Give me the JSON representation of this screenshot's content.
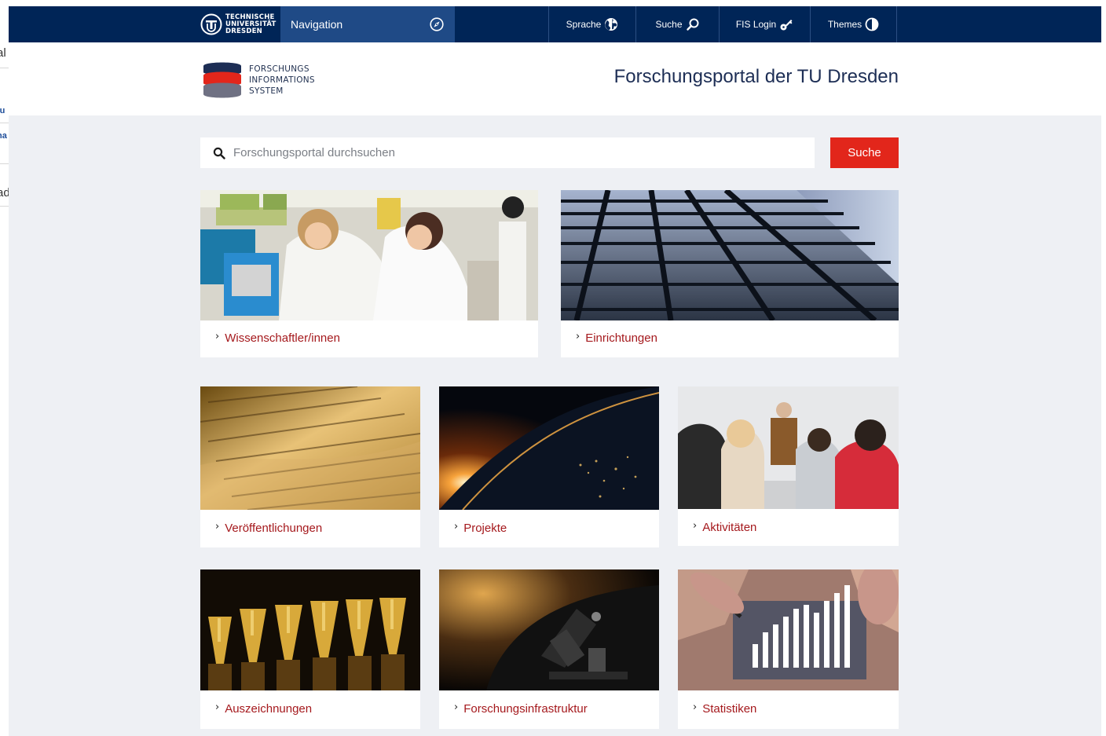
{
  "background_page": {
    "fragments": [
      "al",
      "tu",
      "na",
      "ad"
    ]
  },
  "topbar": {
    "university_logo_text": [
      "TECHNISCHE",
      "UNIVERSITÄT",
      "DRESDEN"
    ],
    "navigation_label": "Navigation",
    "items": [
      {
        "label": "Sprache",
        "icon": "globe-icon"
      },
      {
        "label": "Suche",
        "icon": "search-icon"
      },
      {
        "label": "FIS Login",
        "icon": "key-icon"
      },
      {
        "label": "Themes",
        "icon": "contrast-icon"
      }
    ]
  },
  "header": {
    "fis_logo_text": [
      "FORSCHUNGS",
      "INFORMATIONS",
      "SYSTEM"
    ],
    "title": "Forschungsportal der TU Dresden"
  },
  "search": {
    "placeholder": "Forschungsportal durchsuchen",
    "button_label": "Suche"
  },
  "tiles": [
    {
      "label": "Wissenschaftler/innen",
      "image": "scientists-lab-photo"
    },
    {
      "label": "Einrichtungen",
      "image": "glass-building-photo"
    },
    {
      "label": "Veröffentlichungen",
      "image": "book-pages-photo"
    },
    {
      "label": "Projekte",
      "image": "earth-sunrise-photo"
    },
    {
      "label": "Aktivitäten",
      "image": "lecture-audience-photo"
    },
    {
      "label": "Auszeichnungen",
      "image": "golden-trophies-photo"
    },
    {
      "label": "Forschungsinfrastruktur",
      "image": "microscope-photo"
    },
    {
      "label": "Statistiken",
      "image": "statistics-chart-photo"
    }
  ],
  "colors": {
    "navbar": "#002557",
    "navigation_toggle": "#1f4a86",
    "accent_red": "#e2261b",
    "link_red": "#a5191d",
    "page_background": "#eef0f4"
  }
}
